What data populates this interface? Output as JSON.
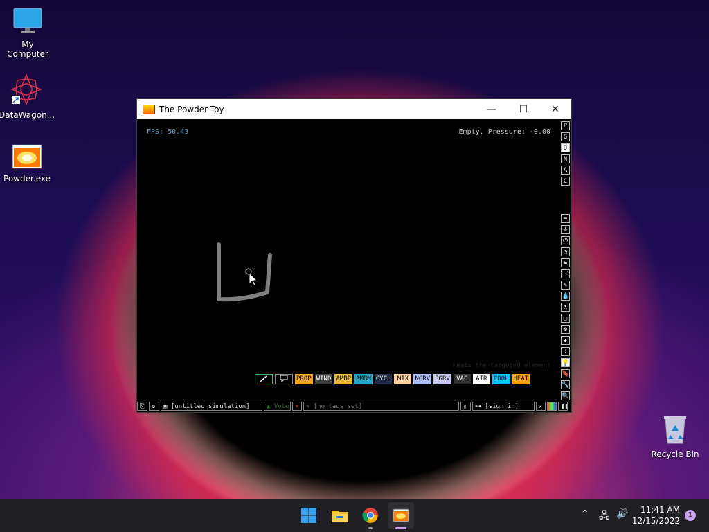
{
  "desktop": {
    "icons": [
      {
        "label": "My Computer",
        "icon": "monitor-icon"
      },
      {
        "label": "DataWagon...",
        "icon": "datawagon-icon"
      },
      {
        "label": "Powder.exe",
        "icon": "powder-toy-icon"
      },
      {
        "label": "Recycle Bin",
        "icon": "recycle-bin-icon"
      }
    ]
  },
  "window": {
    "title": "The Powder Toy",
    "controls": {
      "minimize": "—",
      "maximize": "☐",
      "close": "✕"
    }
  },
  "hud": {
    "fps": "FPS: 50.43",
    "status": "Empty, Pressure: -0.00",
    "hint": "Heats the targeted element"
  },
  "sidebar_top": [
    "P",
    "G",
    "D",
    "N",
    "A",
    "C"
  ],
  "sidebar_active": "D",
  "sidebar_icons": [
    "keyboard-icon",
    "plug-icon",
    "power-icon",
    "gauge-icon",
    "arrows-icon",
    "spray-icon",
    "pen-icon",
    "drop-icon",
    "flask-icon",
    "box-icon",
    "radiation-icon",
    "star-icon",
    "dots-icon",
    "bulb-icon",
    "bookmark-icon",
    "tools-icon",
    "search-icon"
  ],
  "tools": [
    {
      "label": "PROP",
      "bg": "#f5a623",
      "fg": "#000000"
    },
    {
      "label": "WIND",
      "bg": "#404040",
      "fg": "#ffffff"
    },
    {
      "label": "AMBP",
      "bg": "#e8b830",
      "fg": "#000000"
    },
    {
      "label": "AMBM",
      "bg": "#20a8c8",
      "fg": "#000000"
    },
    {
      "label": "CYCL",
      "bg": "#202a44",
      "fg": "#ffffff"
    },
    {
      "label": "MIX",
      "bg": "#ffd0a0",
      "fg": "#000000"
    },
    {
      "label": "NGRV",
      "bg": "#b0c0ff",
      "fg": "#000000"
    },
    {
      "label": "PGRV",
      "bg": "#c8c8f0",
      "fg": "#000000"
    },
    {
      "label": "VAC",
      "bg": "#303030",
      "fg": "#ffffff"
    },
    {
      "label": "AIR",
      "bg": "#ffffff",
      "fg": "#000000"
    },
    {
      "label": "COOL",
      "bg": "#00c8ff",
      "fg": "#000000"
    },
    {
      "label": "HEAT",
      "bg": "#ffa000",
      "fg": "#000000"
    }
  ],
  "statusbar": {
    "sim_name": "[untitled simulation]",
    "vote": "Vote",
    "tags": "[no tags set]",
    "sign_in": "[sign in]"
  },
  "taskbar": {
    "apps": [
      "windows-start-icon",
      "file-explorer-icon",
      "chrome-icon",
      "powder-toy-icon"
    ],
    "time": "11:41 AM",
    "date": "12/15/2022",
    "notifications": "1"
  }
}
